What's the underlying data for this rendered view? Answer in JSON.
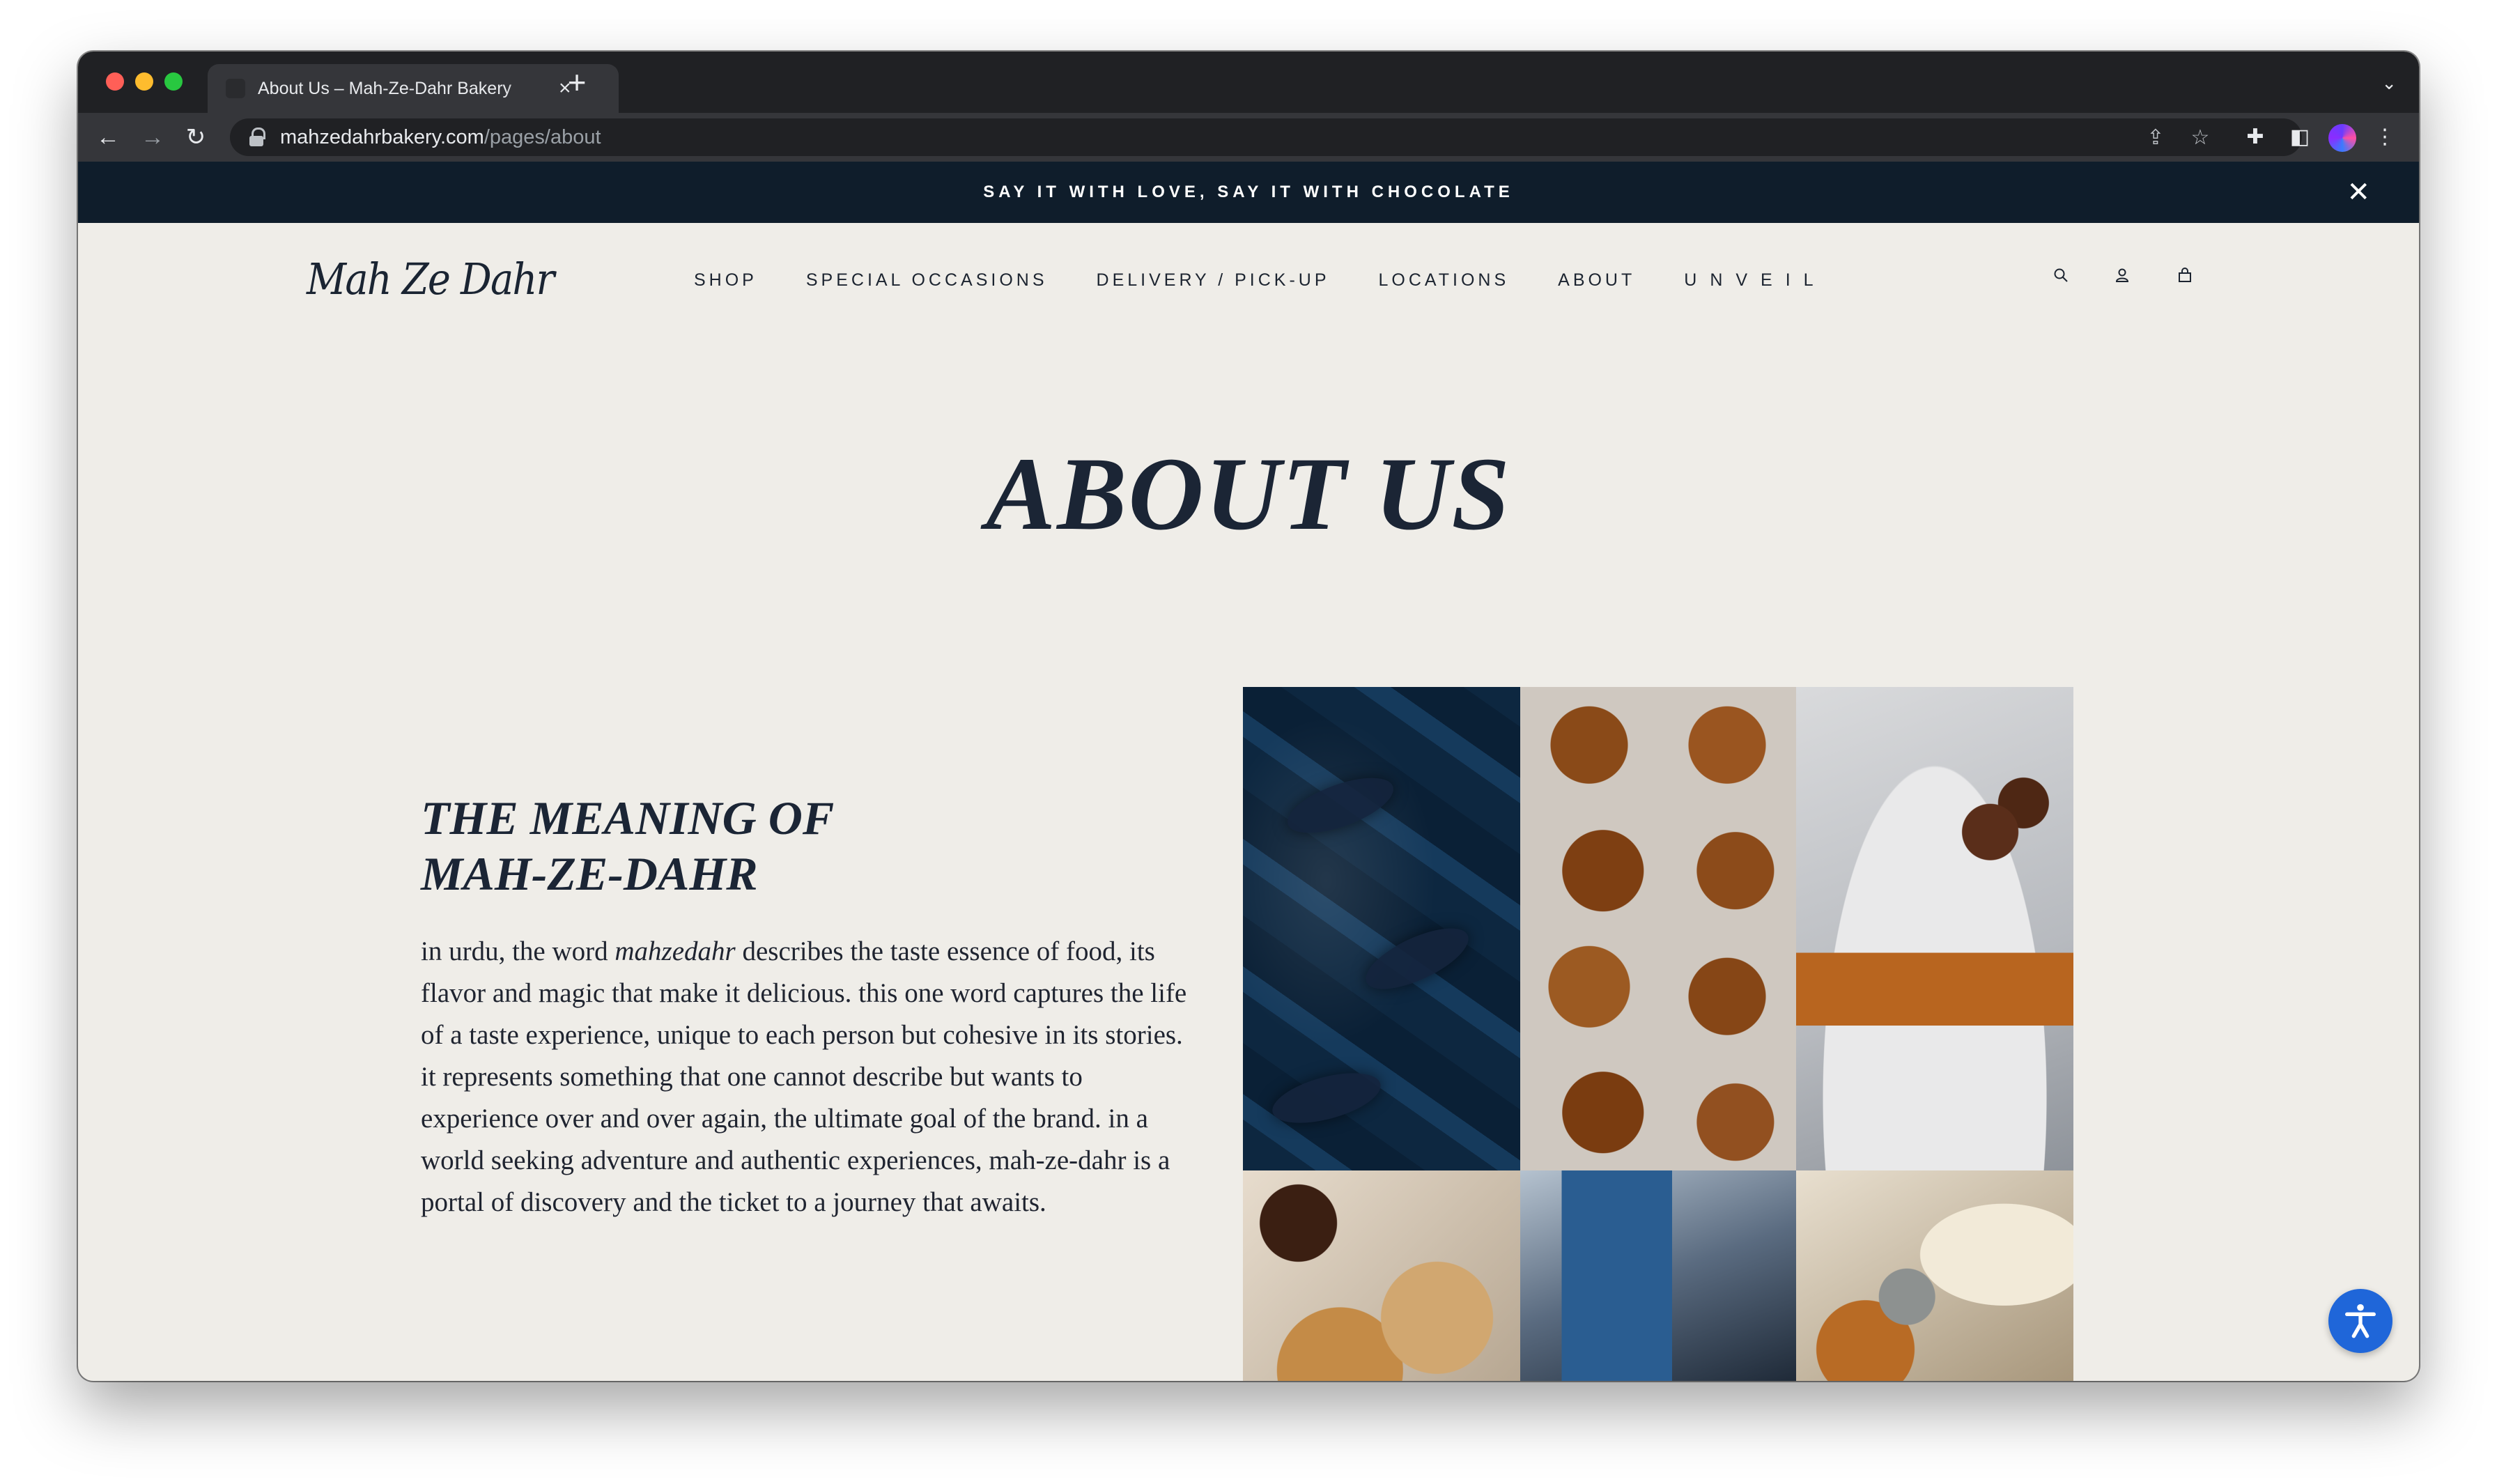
{
  "browser": {
    "tab_title": "About Us – Mah-Ze-Dahr Bakery",
    "tab_close": "×",
    "new_tab": "+",
    "tab_list": "⌄",
    "url_host": "mahzedahrbakery.com",
    "url_path": "/pages/about"
  },
  "announcement": {
    "text": "SAY IT WITH LOVE, SAY IT WITH CHOCOLATE",
    "close": "✕"
  },
  "header": {
    "logo": "Mah Ze Dahr",
    "nav": [
      "SHOP",
      "SPECIAL OCCASIONS",
      "DELIVERY / PICK-UP",
      "LOCATIONS",
      "ABOUT",
      "UNVEIL"
    ]
  },
  "page": {
    "title": "ABOUT US",
    "section_heading_line1": "THE MEANING OF",
    "section_heading_line2": "MAH-ZE-DAHR",
    "body_before": "in urdu, the word ",
    "body_emphasis": "mahzedahr",
    "body_after": " describes the taste essence of food, its flavor and magic that make it delicious. this one word captures the life of a taste experience, unique to each person but cohesive in its stories. it represents something that one cannot describe but wants to experience over and over again, the ultimate goal of the brand. in a world seeking adventure and authentic experiences, mah-ze-dahr is a portal of discovery and the ticket to a journey that awaits."
  },
  "colors": {
    "announce_bg": "#0f1d2b",
    "page_bg": "#efede8",
    "text_navy": "#1b2535",
    "a11y_blue": "#1f66d9"
  }
}
